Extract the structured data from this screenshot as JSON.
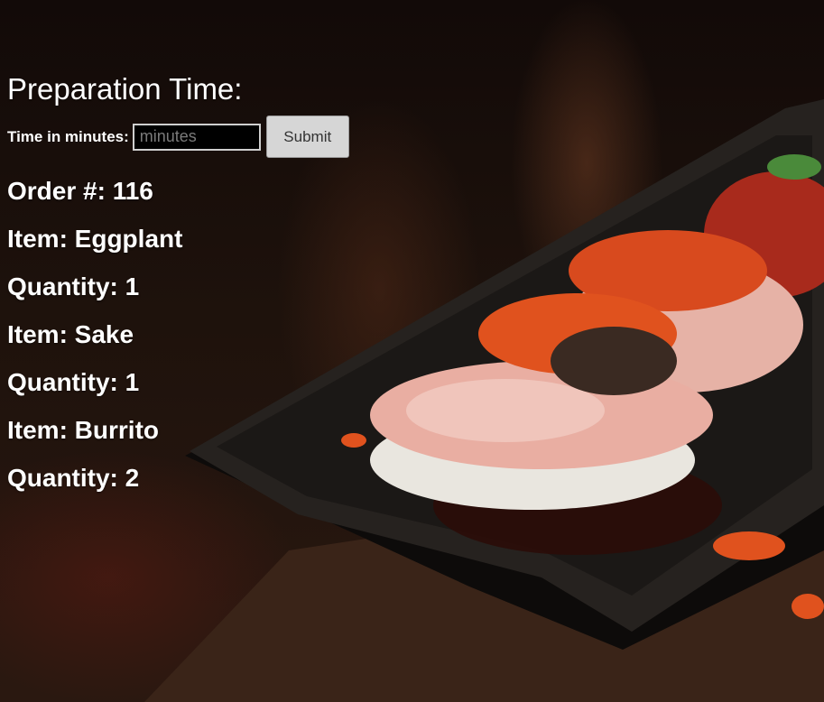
{
  "header": {
    "title": "Preparation Time:"
  },
  "form": {
    "label": "Time in minutes:",
    "input_placeholder": "minutes",
    "input_value": "",
    "submit_label": "Submit"
  },
  "order": {
    "number_label": "Order #: 116",
    "items": [
      {
        "item": "Item: Eggplant",
        "quantity": "Quantity: 1"
      },
      {
        "item": "Item: Sake",
        "quantity": "Quantity: 1"
      },
      {
        "item": "Item: Burrito",
        "quantity": "Quantity: 2"
      }
    ]
  },
  "background": {
    "image": "sushi-photo",
    "accent": "#c0391b"
  }
}
